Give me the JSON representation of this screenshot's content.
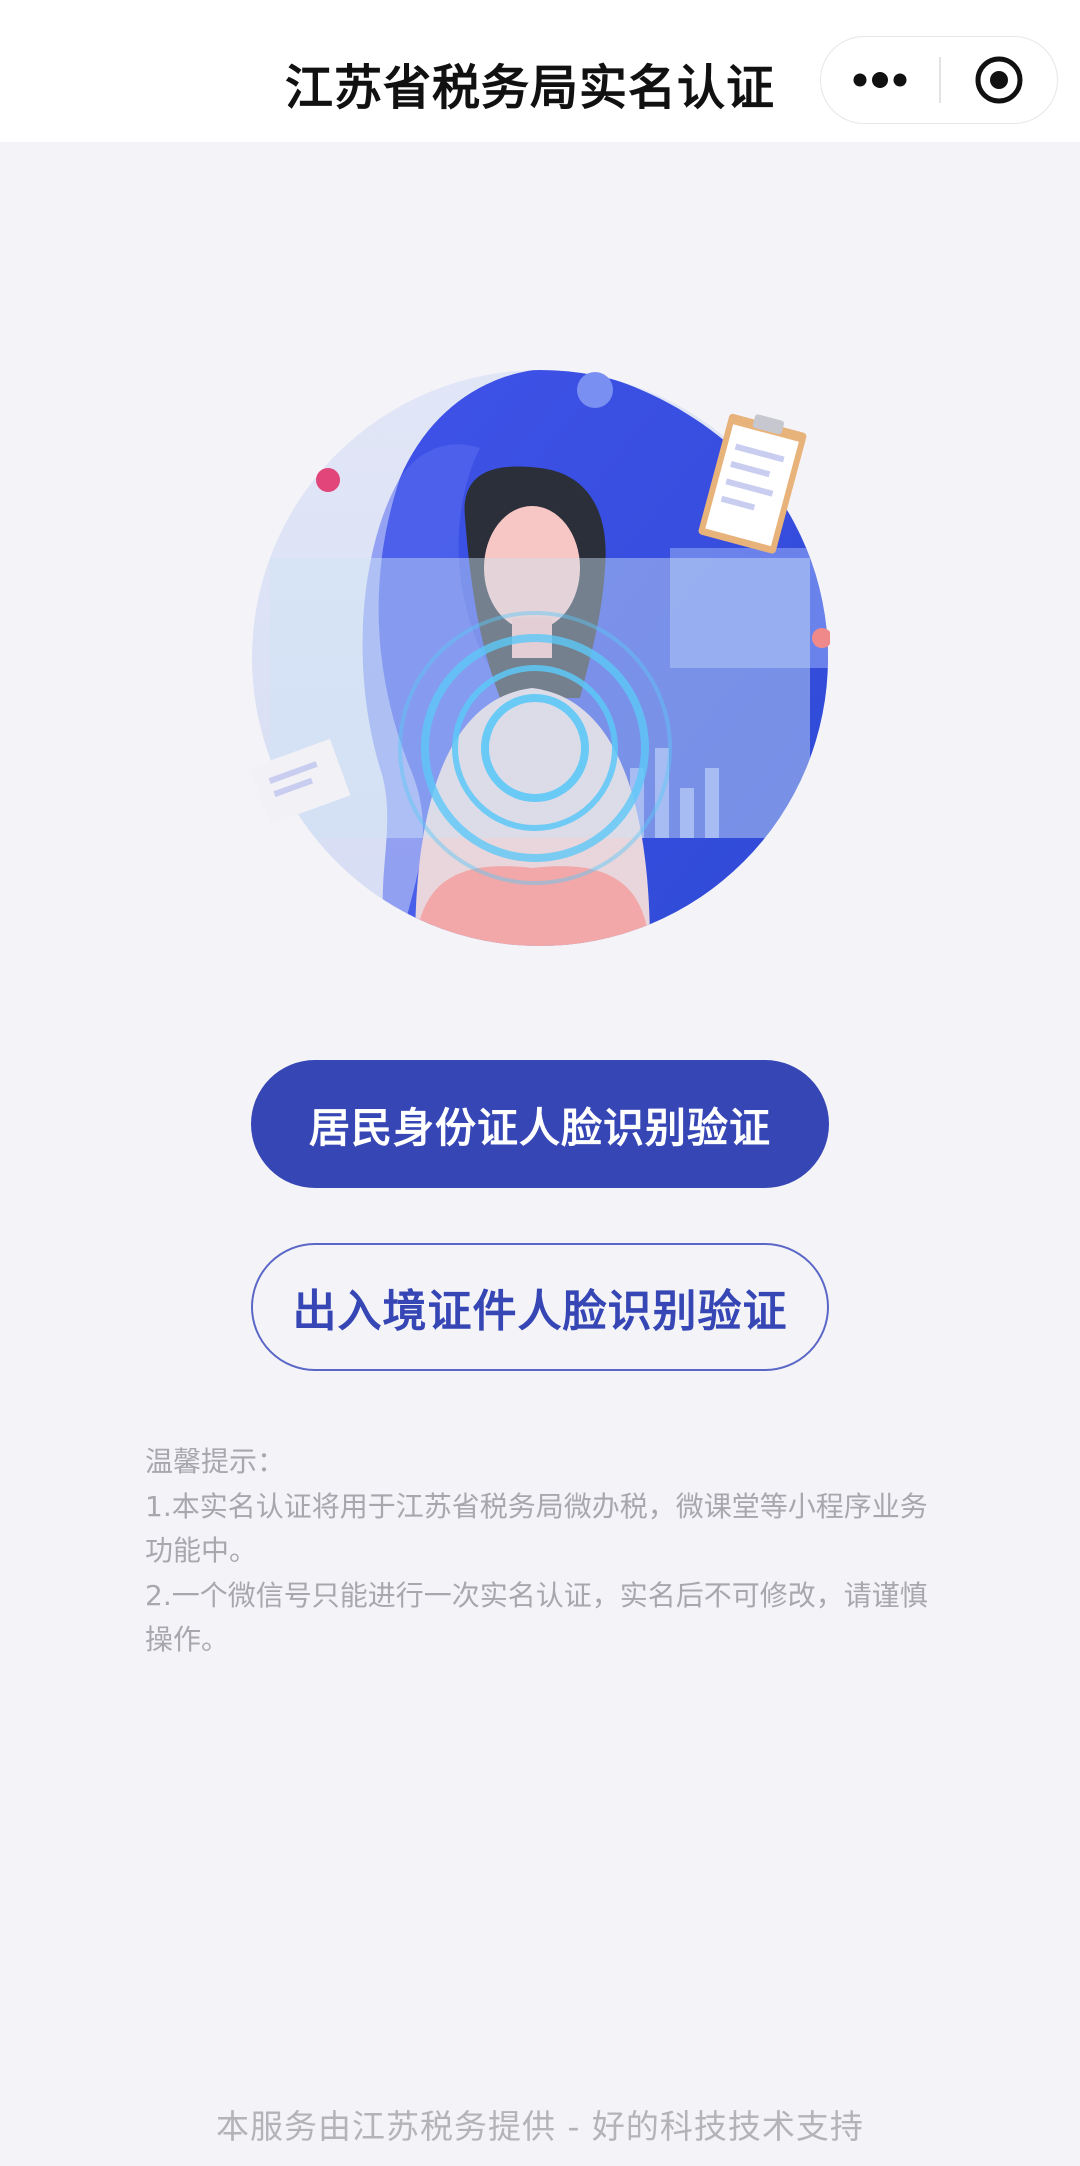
{
  "navbar": {
    "title": "江苏省税务局实名认证",
    "more_icon": "more-dots-icon",
    "close_icon": "target-close-icon"
  },
  "illustration": {
    "icon": "face-recognition-illustration"
  },
  "buttons": {
    "resident_id": "居民身份证人脸识别验证",
    "entry_exit": "出入境证件人脸识别验证"
  },
  "tips": {
    "heading": "温馨提示：",
    "item1": "1.本实名认证将用于江苏省税务局微办税，微课堂等小程序业务功能中。",
    "item2": "2.一个微信号只能进行一次实名认证，实名后不可修改，请谨慎操作。"
  },
  "footer": {
    "text": "本服务由江苏税务提供 - 好的科技技术支持"
  },
  "colors": {
    "primary": "#3646b5",
    "background": "#f4f4f8",
    "tip_text": "#a7a7ad"
  }
}
